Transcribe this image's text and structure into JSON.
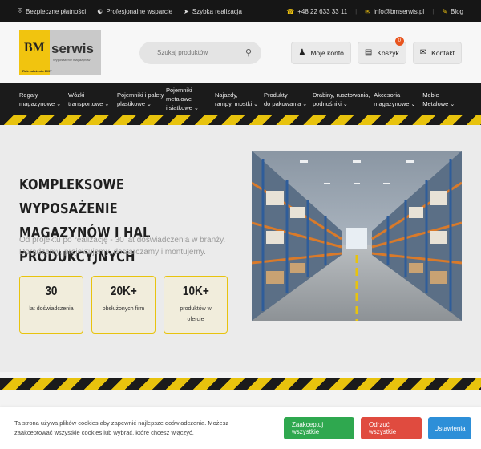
{
  "topbar": {
    "secure_payments": "Bezpieczne płatności",
    "support": "Profesjonalne wsparcie",
    "fast": "Szybka realizacja",
    "phone": "+48 22 633 33 11",
    "email": "info@bmserwis.pl",
    "blog": "Blog"
  },
  "logo": {
    "bm": "BM",
    "serwis": "serwis",
    "tagline": "Wyposażenie magazynów",
    "since": "Rok założenia 1997"
  },
  "search": {
    "placeholder": "Szukaj produktów"
  },
  "header_buttons": {
    "account": "Moje konto",
    "cart": "Koszyk",
    "cart_count": "0",
    "contact": "Kontakt"
  },
  "nav": [
    {
      "line1": "Regały",
      "line2": "magazynowe"
    },
    {
      "line1": "Wózki",
      "line2": "transportowe"
    },
    {
      "line1": "Pojemniki i palety",
      "line2": "plastikowe"
    },
    {
      "line1": "Pojemniki metalowe",
      "line2": "i siatkowe"
    },
    {
      "line1": "Najazdy,",
      "line2": "rampy, mostki"
    },
    {
      "line1": "Produkty",
      "line2": "do pakowania"
    },
    {
      "line1": "Drabiny, rusztowania,",
      "line2": "podnośniki"
    },
    {
      "line1": "Akcesoria",
      "line2": "magazynowe"
    },
    {
      "line1": "Meble",
      "line2": "Metalowe"
    }
  ],
  "hero": {
    "title": "KOMPLEKSOWE WYPOSAŻENIE MAGAZYNÓW I HAL PRODUKCYJNYCH",
    "subtitle": "Od projektu po realizację - 30 lat doświadczenia w branży. Doradzamy, projektujemy, dostarczamy i montujemy.",
    "stats": [
      {
        "value": "30",
        "label": "lat doświadczenia"
      },
      {
        "value": "20K+",
        "label": "obsłużonych firm"
      },
      {
        "value": "10K+",
        "label": "produktów w ofercie"
      }
    ]
  },
  "cookie": {
    "text": "Ta strona używa plików cookies aby zapewnić najlepsze doświadczenia. Możesz zaakceptować wszystkie cookies lub wybrać, które chcesz włączyć.",
    "accept": "Zaakceptuj wszystkie",
    "reject": "Odrzuć wszystkie",
    "settings": "Ustawienia"
  },
  "colors": {
    "accent_yellow": "#e8c30d",
    "dark": "#1b1b1b",
    "accept_green": "#2fa84f",
    "reject_red": "#e04b3f",
    "settings_blue": "#2d8fd8"
  }
}
